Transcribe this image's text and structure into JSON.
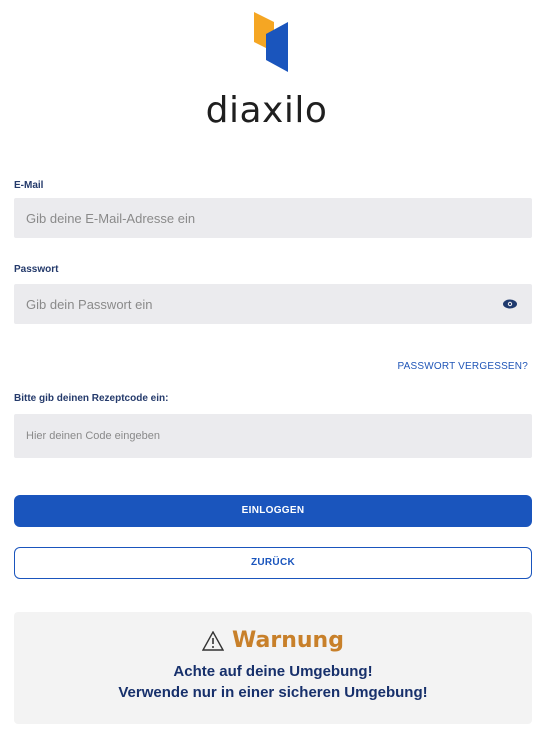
{
  "brand": {
    "name": "diaxilo",
    "colors": {
      "orange": "#f5a623",
      "blue": "#1a55bd"
    }
  },
  "email": {
    "label": "E-Mail",
    "placeholder": "Gib deine E-Mail-Adresse ein"
  },
  "password": {
    "label": "Passwort",
    "placeholder": "Gib dein Passwort ein",
    "toggle_icon": "eye-icon"
  },
  "forgot_link": "PASSWORT VERGESSEN?",
  "code": {
    "label": "Bitte gib deinen Rezeptcode ein:",
    "placeholder": "Hier deinen Code eingeben"
  },
  "buttons": {
    "login": "EINLOGGEN",
    "back": "ZURÜCK"
  },
  "warning": {
    "icon": "warning-triangle-icon",
    "title": "Warnung",
    "line1": "Achte auf deine Umgebung!",
    "line2": "Verwende nur in einer sicheren Umgebung!"
  }
}
